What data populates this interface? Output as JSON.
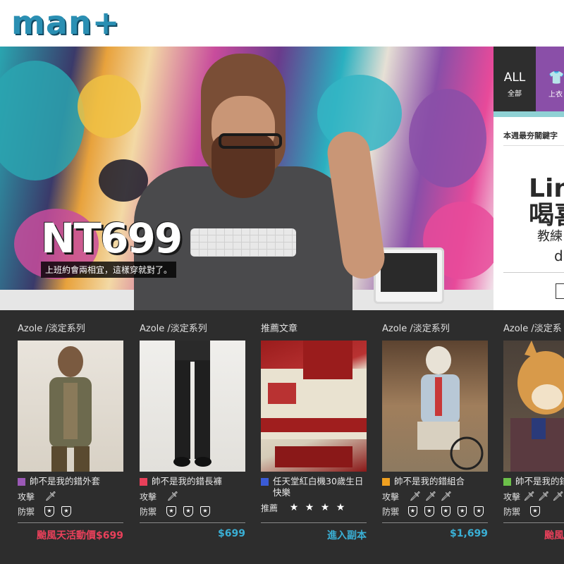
{
  "header": {
    "logo_text": "man+"
  },
  "hero": {
    "price": "NT699",
    "tagline": "上班約會兩相宜，這樣穿就對了。"
  },
  "right_panel": {
    "tab_all_en": "ALL",
    "tab_all_zh": "全部",
    "tab_top_zh": "上衣",
    "heading": "本週最夯關鍵字",
    "big_line1": "Lin",
    "big_line2": "喝喜",
    "line3": "教練",
    "line4": "d"
  },
  "cards": [
    {
      "title": "Azole /淡定系列",
      "name": "帥不是我的錯外套",
      "swatch": "#9b59b6",
      "attack_label": "攻擊",
      "attack_count": 1,
      "defense_label": "防禦",
      "defense_count": 2,
      "price": "颱風天活動價$699",
      "price_color": "#e8405a"
    },
    {
      "title": "Azole /淡定系列",
      "name": "帥不是我的錯長褲",
      "swatch": "#e8405a",
      "attack_label": "攻擊",
      "attack_count": 1,
      "defense_label": "防禦",
      "defense_count": 3,
      "price": "$699",
      "price_color": "#3ab0d6"
    },
    {
      "title": "推薦文章",
      "name": "任天堂紅白機30歲生日快樂",
      "swatch": "#3a5bd6",
      "rec_label": "推薦",
      "stars": 4,
      "price": "進入副本",
      "price_color": "#3ab0d6"
    },
    {
      "title": "Azole /淡定系列",
      "name": "帥不是我的錯組合",
      "swatch": "#f0a020",
      "attack_label": "攻擊",
      "attack_count": 3,
      "defense_label": "防禦",
      "defense_count": 5,
      "price": "$1,699",
      "price_color": "#3ab0d6"
    },
    {
      "title": "Azole /淡定系",
      "name": "帥不是我的錯",
      "swatch": "#6cc04a",
      "attack_label": "攻擊",
      "attack_count": 3,
      "defense_label": "防禦",
      "defense_count": 1,
      "price": "颱風",
      "price_color": "#e8405a"
    }
  ]
}
